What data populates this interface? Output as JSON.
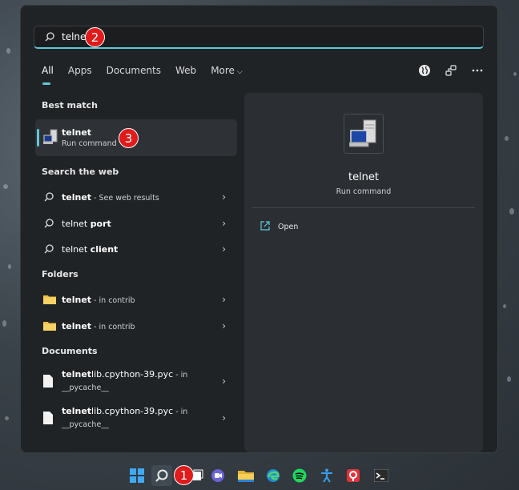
{
  "search": {
    "query": "telnet"
  },
  "tabs": [
    {
      "label": "All"
    },
    {
      "label": "Apps"
    },
    {
      "label": "Documents"
    },
    {
      "label": "Web"
    },
    {
      "label": "More"
    }
  ],
  "badges": {
    "b1": "1",
    "b2": "2",
    "b3": "3"
  },
  "headings": {
    "best_match": "Best match",
    "search_web": "Search the web",
    "folders": "Folders",
    "documents": "Documents"
  },
  "best_match": {
    "name": "telnet",
    "type": "Run command"
  },
  "web": [
    {
      "bold": "telnet",
      "rest": " - See web results"
    },
    {
      "bold": "",
      "rest": "telnet ",
      "bold2": "port"
    },
    {
      "bold": "",
      "rest": "telnet ",
      "bold2": "client"
    }
  ],
  "folders": [
    {
      "bold": "telnet",
      "rest": " - in contrib"
    },
    {
      "bold": "telnet",
      "rest": " - in contrib"
    }
  ],
  "documents": [
    {
      "bold": "telnet",
      "rest": "lib.cpython-39.pyc",
      "loc": " - in",
      "loc2": "__pycache__"
    },
    {
      "bold": "telnet",
      "rest": "lib.cpython-39.pyc",
      "loc": " - in",
      "loc2": "__pycache__"
    }
  ],
  "preview": {
    "name": "telnet",
    "type": "Run command",
    "open": "Open"
  },
  "colors": {
    "accent": "#5ec9d9",
    "badge": "#e01b1b"
  }
}
